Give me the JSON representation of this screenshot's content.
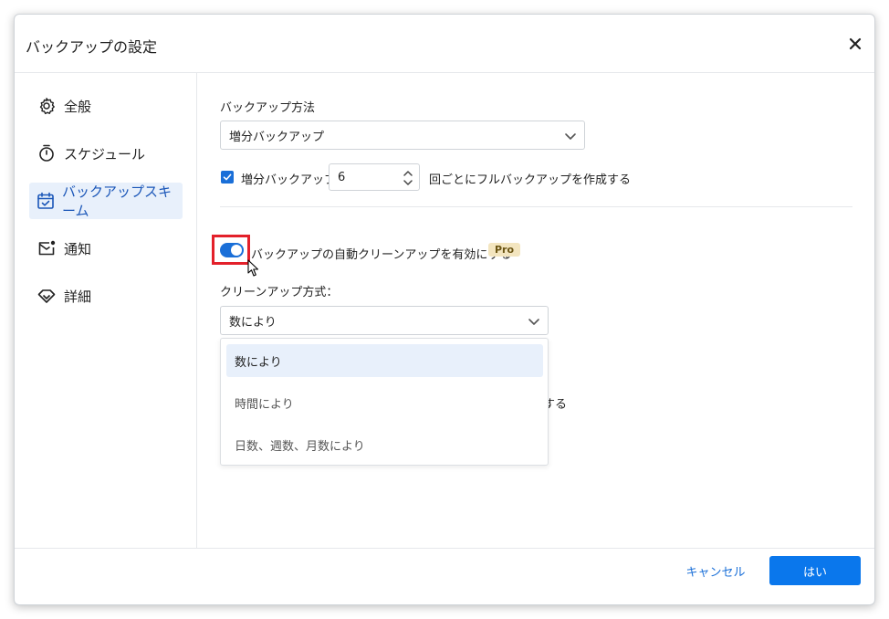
{
  "dialog": {
    "title": "バックアップの設定"
  },
  "sidebar": {
    "items": [
      {
        "label": "全般",
        "icon": "gear-icon"
      },
      {
        "label": "スケジュール",
        "icon": "timer-icon"
      },
      {
        "label": "バックアップスキーム",
        "icon": "calendar-check-icon",
        "active": true
      },
      {
        "label": "通知",
        "icon": "mail-notification-icon"
      },
      {
        "label": "詳細",
        "icon": "diamond-icon"
      }
    ]
  },
  "backup": {
    "method_label": "バックアップ方法",
    "method_value": "増分バックアップ",
    "incremental_checkbox_label": "増分バックアップ",
    "incremental_checked": true,
    "incremental_count": "6",
    "incremental_suffix": "回ごとにフルバックアップを作成する"
  },
  "cleanup": {
    "toggle_label": "バックアップの自動クリーンアップを有効にする",
    "toggle_on": true,
    "pro_badge": "Pro",
    "method_label": "クリーンアップ方式：",
    "method_value": "数により",
    "options": [
      "数により",
      "時間により",
      "日数、週数、月数により"
    ],
    "selected_index": 0,
    "obscured_text": "する"
  },
  "footer": {
    "cancel_label": "キャンセル",
    "ok_label": "はい"
  },
  "colors": {
    "accent": "#1a6fd8",
    "primary_button": "#0a77ec",
    "highlight_frame": "#e3202a",
    "pro_badge_bg": "#f3e5bf"
  }
}
